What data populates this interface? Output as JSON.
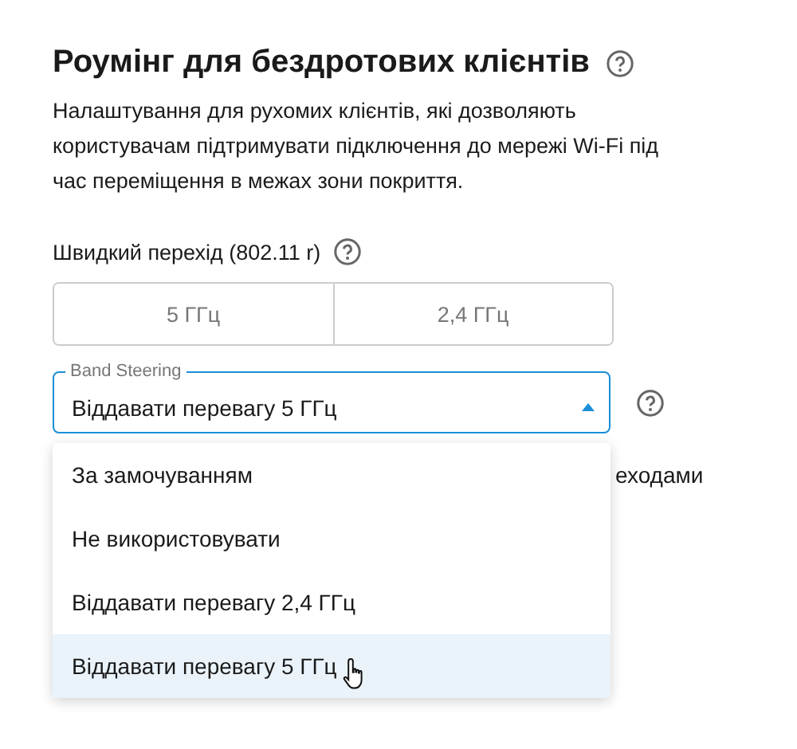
{
  "section": {
    "title": "Роумінг для бездротових клієнтів",
    "description": "Налаштування для рухомих клієнтів, які дозволяють користувачам підтримувати підключення до мережі Wi-Fi під час переміщення в межах зони покриття."
  },
  "fast_transition": {
    "label": "Швидкий перехід (802.11 r)",
    "segments": [
      {
        "label": "5 ГГц",
        "selected": false
      },
      {
        "label": "2,4 ГГц",
        "selected": false
      }
    ]
  },
  "band_steering": {
    "label": "Band Steering",
    "value": "Віддавати перевагу 5 ГГц",
    "expanded": true,
    "options": [
      {
        "label": "За замочуванням",
        "selected": false
      },
      {
        "label": "Не використовувати",
        "selected": false
      },
      {
        "label": "Віддавати перевагу 2,4 ГГц",
        "selected": false
      },
      {
        "label": "Віддавати перевагу 5 ГГц",
        "selected": true
      }
    ]
  },
  "hidden_text": "еходами"
}
